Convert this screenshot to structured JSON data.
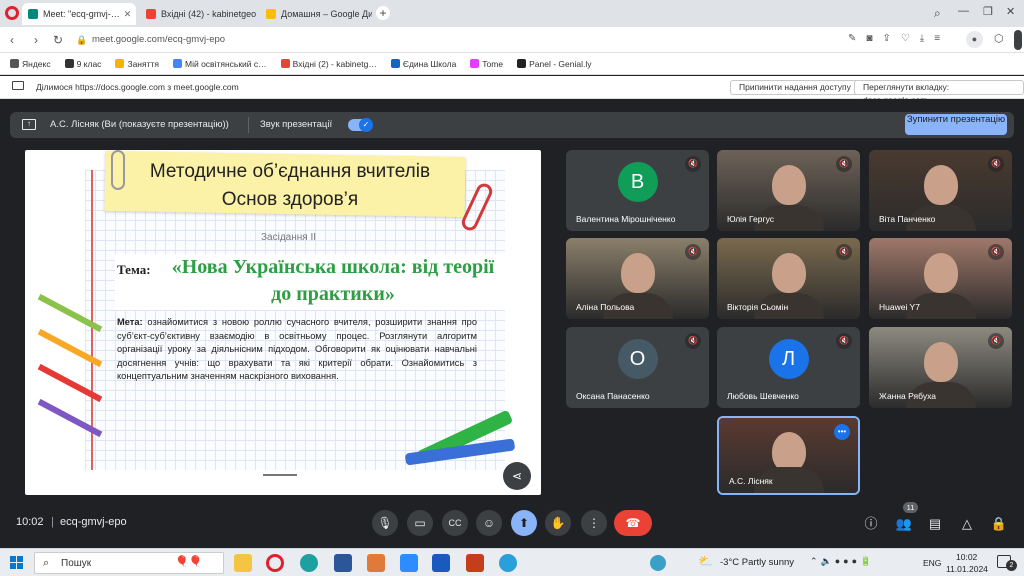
{
  "tabs": [
    {
      "label": "Meet: \"ecq-gmvj-…",
      "fav": "#00897b"
    },
    {
      "label": "Вхідні (42) - kabinetgeog…",
      "fav": "#ea4335"
    },
    {
      "label": "Домашня – Google Диск",
      "fav": "#fbbc04"
    }
  ],
  "address": {
    "url": "meet.google.com/ecq-gmvj-epo"
  },
  "bookmarks": [
    {
      "label": "Яндекс",
      "color": "#555"
    },
    {
      "label": "9 клас",
      "color": "#333"
    },
    {
      "label": "Заняття",
      "color": "#f4b400"
    },
    {
      "label": "Мій освітянський с…",
      "color": "#4285f4"
    },
    {
      "label": "Вхідні (2) - kabinetg…",
      "color": "#ea4335"
    },
    {
      "label": "Єдина Школа",
      "color": "#1565c0"
    },
    {
      "label": "Tome",
      "color": "#e040fb"
    },
    {
      "label": "Panel - Genial.ly",
      "color": "#222"
    }
  ],
  "share": {
    "notice": "Ділимося https://docs.google.com з meet.google.com",
    "stop_access": "Припинити надання доступу",
    "view_tab": "Переглянути вкладку: docs.google.com"
  },
  "presenting": {
    "label": "А.С. Лісняк (Ви (показуєте презентацію))",
    "sound_label": "Звук презентації",
    "stop_button": "Зупинити презентацію"
  },
  "slide": {
    "title": "Методичне об’єднання вчителів Основ здоров’я",
    "session": "Засідання ІІ",
    "topic_label": "Тема:",
    "topic": "«Нова Українська школа: від теорії до практики»",
    "goal_label": "Мета:",
    "goal_text": "ознайомитися з новою роллю сучасного вчителя, розширити знання про суб’єкт-суб’єктивну взаємодію в освітньому процес. Розглянути алгоритм організації уроку за діяльнісним підходом. Обговорити як оцінювати навчальні досягнення учнів: що врахувати та які критерії обрати. Ознайомитись з концептуальним значенням наскрізного виховання."
  },
  "participants": [
    {
      "name": "Валентина Мірошніченко",
      "initial": "В",
      "avatar_color": "#0f9d58",
      "video": false
    },
    {
      "name": "Юлія Гергус",
      "video": true,
      "bg": "#6d6258"
    },
    {
      "name": "Віта Панченко",
      "video": true,
      "bg": "#4a3a30"
    },
    {
      "name": "Аліна Польова",
      "video": true,
      "bg": "#8a7f6a"
    },
    {
      "name": "Вікторія Сьомін",
      "video": true,
      "bg": "#7a6a4e"
    },
    {
      "name": "Huawei Y7",
      "video": true,
      "bg": "#a0786a"
    },
    {
      "name": "Оксана Панасенко",
      "initial": "О",
      "avatar_color": "#455a64",
      "video": false
    },
    {
      "name": "Любовь Шевченко",
      "initial": "Л",
      "avatar_color": "#1a73e8",
      "video": false
    },
    {
      "name": "Жанна Рябуха",
      "video": true,
      "bg": "#8d8a80"
    },
    {
      "name": "А.С. Лісняк",
      "video": true,
      "bg": "#5a3a30"
    }
  ],
  "meeting": {
    "time": "10:02",
    "code": "ecq-gmvj-epo",
    "people_count": "11"
  },
  "taskbar": {
    "search": "Пошук",
    "weather": "-3°C  Partly sunny",
    "lang": "ENG",
    "time": "10:02",
    "date": "11.01.2024",
    "notif": "2"
  }
}
